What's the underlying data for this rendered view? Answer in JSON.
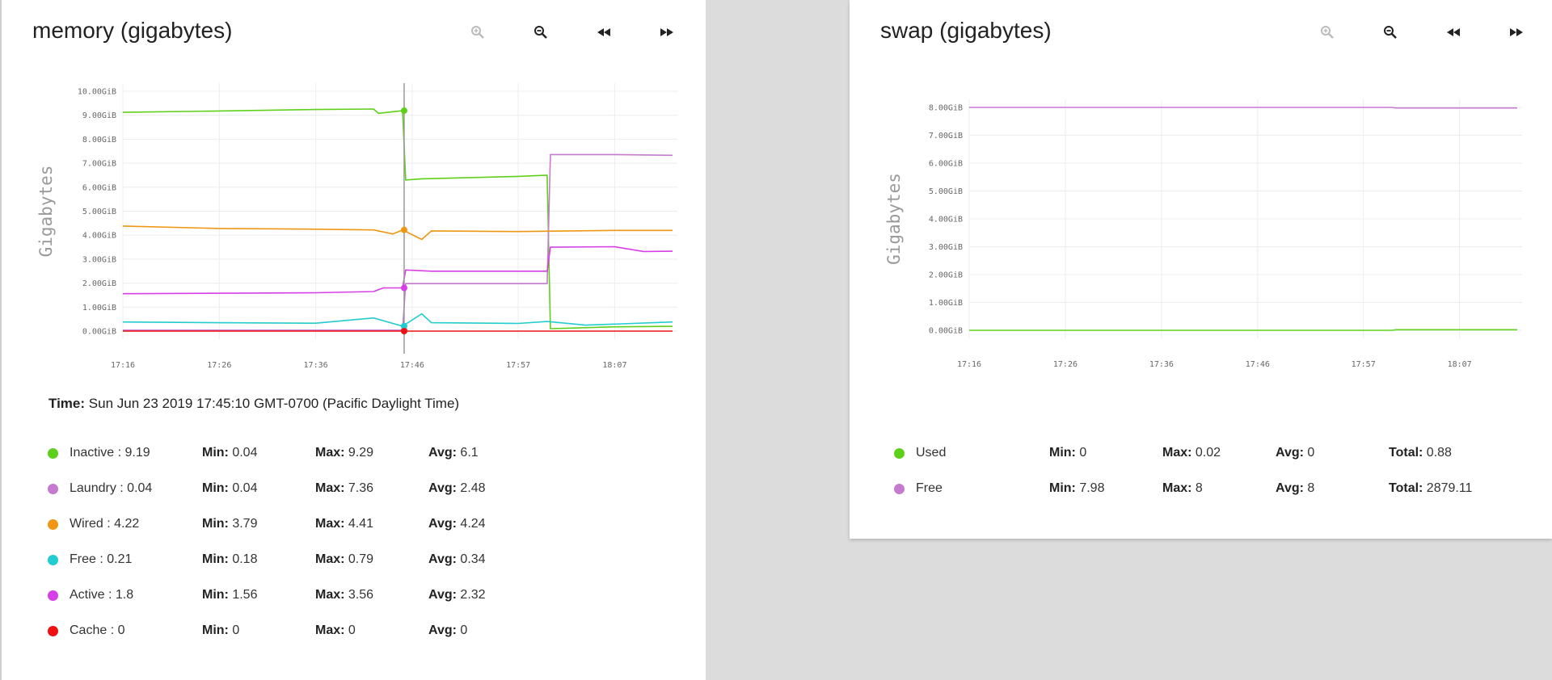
{
  "memory": {
    "title": "memory (gigabytes)",
    "toolbar": {
      "zoom_in_icon": "zoom-in-icon",
      "zoom_out_icon": "zoom-out-icon",
      "back_icon": "rewind-icon",
      "forward_icon": "fast-forward-icon"
    },
    "time_label": "Time:",
    "time_value": "Sun Jun 23 2019 17:45:10 GMT-0700 (Pacific Daylight Time)",
    "stat_labels": {
      "min": "Min:",
      "max": "Max:",
      "avg": "Avg:"
    },
    "legend": [
      {
        "label": "Inactive : 9.19",
        "color": "#5fd01a",
        "min": "0.04",
        "max": "9.29",
        "avg": "6.1"
      },
      {
        "label": "Laundry : 0.04",
        "color": "#c57ad0",
        "min": "0.04",
        "max": "7.36",
        "avg": "2.48"
      },
      {
        "label": "Wired : 4.22",
        "color": "#ef9613",
        "min": "3.79",
        "max": "4.41",
        "avg": "4.24"
      },
      {
        "label": "Free : 0.21",
        "color": "#22ccd0",
        "min": "0.18",
        "max": "0.79",
        "avg": "0.34"
      },
      {
        "label": "Active : 1.8",
        "color": "#d63fe8",
        "min": "1.56",
        "max": "3.56",
        "avg": "2.32"
      },
      {
        "label": "Cache : 0",
        "color": "#ee1111",
        "min": "0",
        "max": "0",
        "avg": "0"
      }
    ],
    "chart_data": {
      "type": "line",
      "ylabel": "Gigabytes",
      "ylim": [
        0,
        10
      ],
      "yticks": [
        "0.00GiB",
        "1.00GiB",
        "2.00GiB",
        "3.00GiB",
        "4.00GiB",
        "5.00GiB",
        "6.00GiB",
        "7.00GiB",
        "8.00GiB",
        "9.00GiB",
        "10.00GiB"
      ],
      "xticks": [
        "17:16",
        "17:26",
        "17:36",
        "17:46",
        "17:57",
        "18:07"
      ],
      "hover_time": "17:45:10",
      "grid": true,
      "series": [
        {
          "name": "Inactive",
          "color": "#5fd01a",
          "points": [
            [
              "17:16",
              9.12
            ],
            [
              "17:26",
              9.18
            ],
            [
              "17:36",
              9.24
            ],
            [
              "17:42",
              9.26
            ],
            [
              "17:42:30",
              9.08
            ],
            [
              "17:45",
              9.19
            ],
            [
              "17:45:20",
              6.3
            ],
            [
              "17:47",
              6.35
            ],
            [
              "17:57",
              6.45
            ],
            [
              "18:00",
              6.5
            ],
            [
              "18:00:20",
              0.1
            ],
            [
              "18:02",
              0.12
            ],
            [
              "18:07",
              0.18
            ],
            [
              "18:13",
              0.2
            ]
          ]
        },
        {
          "name": "Laundry",
          "color": "#c57ad0",
          "points": [
            [
              "17:16",
              0.04
            ],
            [
              "17:45",
              0.04
            ],
            [
              "17:45:20",
              1.98
            ],
            [
              "18:00",
              1.98
            ],
            [
              "18:00:20",
              7.36
            ],
            [
              "18:07",
              7.36
            ],
            [
              "18:13",
              7.33
            ]
          ]
        },
        {
          "name": "Wired",
          "color": "#ef9613",
          "points": [
            [
              "17:16",
              4.38
            ],
            [
              "17:26",
              4.28
            ],
            [
              "17:36",
              4.25
            ],
            [
              "17:42",
              4.22
            ],
            [
              "17:44",
              4.05
            ],
            [
              "17:45",
              4.22
            ],
            [
              "17:47",
              3.82
            ],
            [
              "17:48",
              4.18
            ],
            [
              "17:57",
              4.15
            ],
            [
              "18:07",
              4.2
            ],
            [
              "18:13",
              4.2
            ]
          ]
        },
        {
          "name": "Free",
          "color": "#22ccd0",
          "points": [
            [
              "17:16",
              0.38
            ],
            [
              "17:26",
              0.35
            ],
            [
              "17:36",
              0.33
            ],
            [
              "17:42",
              0.55
            ],
            [
              "17:44",
              0.32
            ],
            [
              "17:45",
              0.21
            ],
            [
              "17:47",
              0.72
            ],
            [
              "17:48",
              0.35
            ],
            [
              "17:57",
              0.32
            ],
            [
              "18:00",
              0.4
            ],
            [
              "18:04",
              0.25
            ],
            [
              "18:13",
              0.38
            ]
          ]
        },
        {
          "name": "Active",
          "color": "#d63fe8",
          "points": [
            [
              "17:16",
              1.56
            ],
            [
              "17:36",
              1.6
            ],
            [
              "17:42",
              1.65
            ],
            [
              "17:43",
              1.8
            ],
            [
              "17:45",
              1.8
            ],
            [
              "17:45:20",
              2.55
            ],
            [
              "17:48",
              2.5
            ],
            [
              "18:00",
              2.5
            ],
            [
              "18:00:20",
              3.5
            ],
            [
              "18:07",
              3.52
            ],
            [
              "18:10",
              3.32
            ],
            [
              "18:13",
              3.33
            ]
          ]
        },
        {
          "name": "Cache",
          "color": "#ee1111",
          "points": [
            [
              "17:16",
              0
            ],
            [
              "18:13",
              0
            ]
          ]
        }
      ]
    }
  },
  "swap": {
    "title": "swap (gigabytes)",
    "toolbar": {
      "zoom_in_icon": "zoom-in-icon",
      "zoom_out_icon": "zoom-out-icon",
      "back_icon": "rewind-icon",
      "forward_icon": "fast-forward-icon"
    },
    "stat_labels": {
      "min": "Min:",
      "max": "Max:",
      "avg": "Avg:",
      "total": "Total:"
    },
    "legend": [
      {
        "label": "Used",
        "color": "#5fd01a",
        "min": "0",
        "max": "0.02",
        "avg": "0",
        "total": "0.88"
      },
      {
        "label": "Free",
        "color": "#c57ad0",
        "min": "7.98",
        "max": "8",
        "avg": "8",
        "total": "2879.11"
      }
    ],
    "chart_data": {
      "type": "line",
      "ylabel": "Gigabytes",
      "ylim": [
        0,
        8
      ],
      "yticks": [
        "0.00GiB",
        "1.00GiB",
        "2.00GiB",
        "3.00GiB",
        "4.00GiB",
        "5.00GiB",
        "6.00GiB",
        "7.00GiB",
        "8.00GiB"
      ],
      "xticks": [
        "17:16",
        "17:26",
        "17:36",
        "17:46",
        "17:57",
        "18:07"
      ],
      "grid": true,
      "series": [
        {
          "name": "Used",
          "color": "#5fd01a",
          "points": [
            [
              "17:16",
              0
            ],
            [
              "18:00",
              0
            ],
            [
              "18:00:20",
              0.02
            ],
            [
              "18:13",
              0.02
            ]
          ]
        },
        {
          "name": "Free",
          "color": "#c57ad0",
          "points": [
            [
              "17:16",
              8
            ],
            [
              "18:00",
              8
            ],
            [
              "18:00:20",
              7.98
            ],
            [
              "18:13",
              7.98
            ]
          ]
        }
      ]
    }
  }
}
